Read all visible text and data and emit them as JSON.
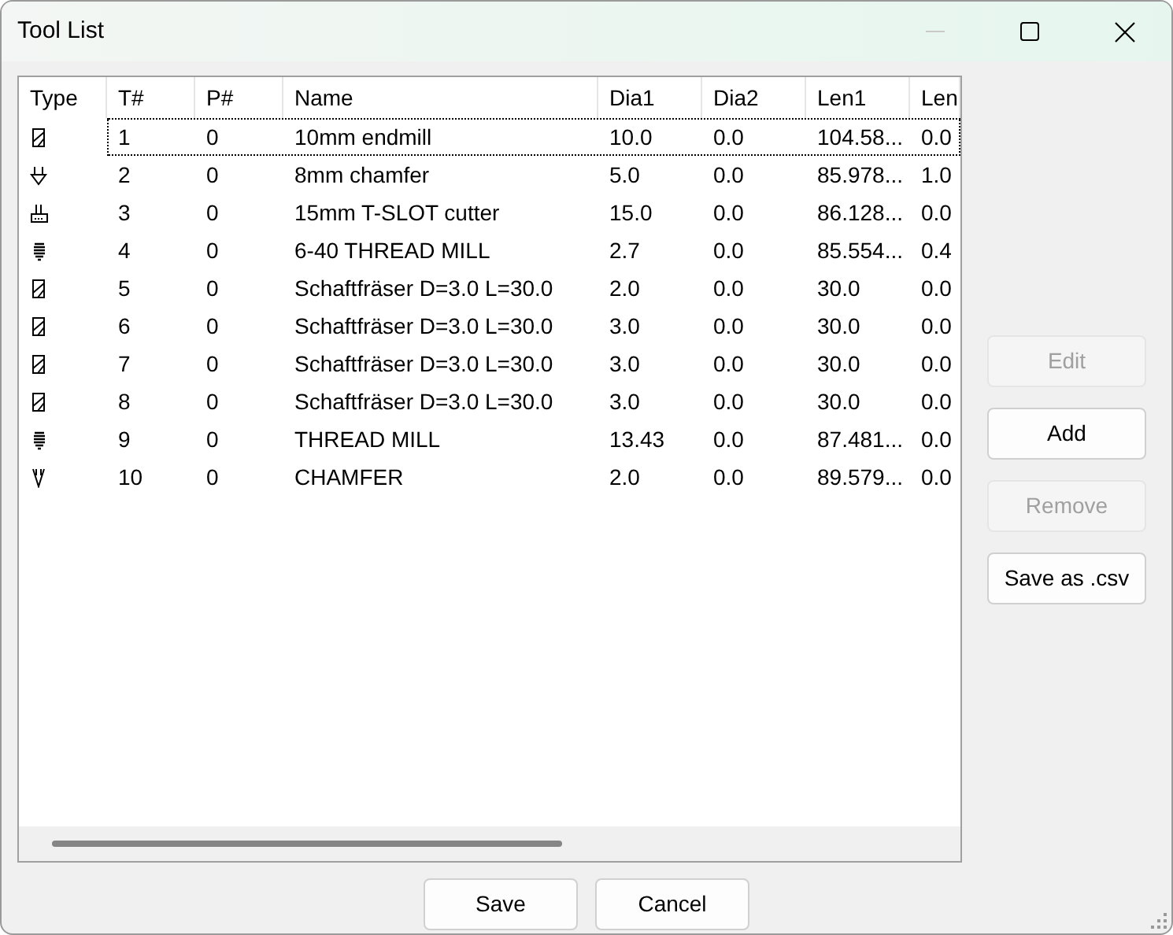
{
  "window": {
    "title": "Tool List",
    "minimize_disabled": true
  },
  "table": {
    "icon_column": "Type",
    "columns": [
      "T#",
      "P#",
      "Name",
      "Dia1",
      "Dia2",
      "Len1",
      "Len"
    ],
    "rows": [
      {
        "kind": "endmill",
        "selected": true,
        "cells": [
          "1",
          "0",
          "10mm endmill",
          "10.0",
          "0.0",
          "104.58...",
          "0.0"
        ]
      },
      {
        "kind": "chamfer",
        "selected": false,
        "cells": [
          "2",
          "0",
          "8mm chamfer",
          "5.0",
          "0.0",
          "85.978...",
          "1.0"
        ]
      },
      {
        "kind": "tslot",
        "selected": false,
        "cells": [
          "3",
          "0",
          "15mm T-SLOT cutter",
          "15.0",
          "0.0",
          "86.128...",
          "0.0"
        ]
      },
      {
        "kind": "threadmill",
        "selected": false,
        "cells": [
          "4",
          "0",
          "6-40 THREAD MILL",
          "2.7",
          "0.0",
          "85.554...",
          "0.4"
        ]
      },
      {
        "kind": "endmill",
        "selected": false,
        "cells": [
          "5",
          "0",
          "Schaftfräser D=3.0 L=30.0",
          "2.0",
          "0.0",
          "30.0",
          "0.0"
        ]
      },
      {
        "kind": "endmill",
        "selected": false,
        "cells": [
          "6",
          "0",
          "Schaftfräser D=3.0 L=30.0",
          "3.0",
          "0.0",
          "30.0",
          "0.0"
        ]
      },
      {
        "kind": "endmill",
        "selected": false,
        "cells": [
          "7",
          "0",
          "Schaftfräser D=3.0 L=30.0",
          "3.0",
          "0.0",
          "30.0",
          "0.0"
        ]
      },
      {
        "kind": "endmill",
        "selected": false,
        "cells": [
          "8",
          "0",
          "Schaftfräser D=3.0 L=30.0",
          "3.0",
          "0.0",
          "30.0",
          "0.0"
        ]
      },
      {
        "kind": "threadmill",
        "selected": false,
        "cells": [
          "9",
          "0",
          "THREAD MILL",
          "13.43",
          "0.0",
          "87.481...",
          "0.0"
        ]
      },
      {
        "kind": "vbit",
        "selected": false,
        "cells": [
          "10",
          "0",
          "CHAMFER",
          "2.0",
          "0.0",
          "89.579...",
          "0.0"
        ]
      }
    ]
  },
  "side_buttons": [
    {
      "label": "Edit",
      "disabled": true
    },
    {
      "label": "Add",
      "disabled": false
    },
    {
      "label": "Remove",
      "disabled": true
    },
    {
      "label": "Save as .csv",
      "disabled": false
    }
  ],
  "bottom_buttons": [
    "Save",
    "Cancel"
  ]
}
